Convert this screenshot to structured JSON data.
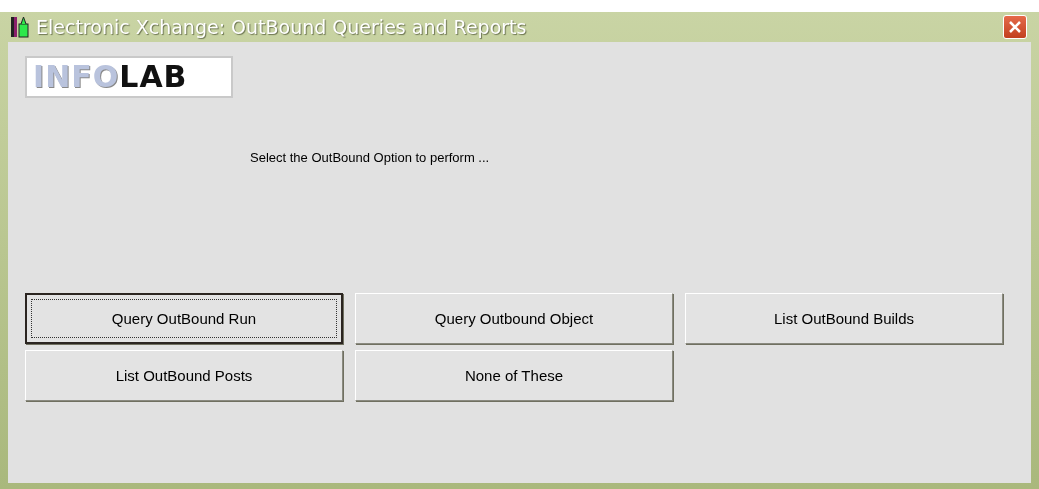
{
  "window": {
    "title": "Electronic Xchange: OutBound Queries and Reports"
  },
  "logo": {
    "light": "INFO",
    "dark": "LAB"
  },
  "prompt": "Select the OutBound Option to perform ...",
  "buttons": [
    {
      "label": "Query OutBound Run",
      "focused": true
    },
    {
      "label": "Query Outbound Object",
      "focused": false
    },
    {
      "label": "List OutBound Builds",
      "focused": false
    },
    {
      "label": "List OutBound Posts",
      "focused": false
    },
    {
      "label": "None of These",
      "focused": false
    }
  ]
}
